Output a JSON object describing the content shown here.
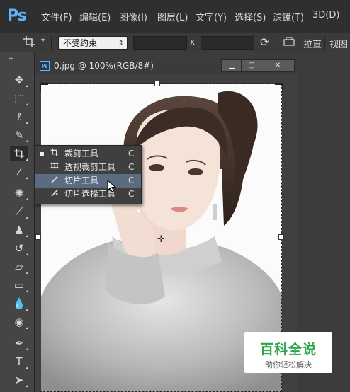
{
  "app": {
    "logo": "Ps"
  },
  "menu": [
    "文件(F)",
    "编辑(E)",
    "图像(I)",
    "图层(L)",
    "文字(Y)",
    "选择(S)",
    "滤镜(T)",
    "3D(D)"
  ],
  "options": {
    "ratio_value": "不受约束",
    "x_label": "x",
    "straighten_label": "拉直",
    "view_label": "视图"
  },
  "document": {
    "icon_text": "Ps",
    "title": "0.jpg @ 100%(RGB/8#)",
    "min_label": "▁",
    "max_label": "□",
    "close_label": "✕"
  },
  "flyout": {
    "items": [
      {
        "label": "裁剪工具",
        "key": "C",
        "bullet": "▪",
        "icon": "crop-icon"
      },
      {
        "label": "透视裁剪工具",
        "key": "C",
        "bullet": "",
        "icon": "perspective-crop-icon"
      },
      {
        "label": "切片工具",
        "key": "C",
        "bullet": "",
        "icon": "slice-icon"
      },
      {
        "label": "切片选择工具",
        "key": "C",
        "bullet": "",
        "icon": "slice-select-icon"
      }
    ],
    "hover_index": 2
  },
  "watermark": {
    "title": "百科全说",
    "subtitle": "助你轻松解决"
  },
  "colors": {
    "ps_blue": "#5fb3f6",
    "watermark_green": "#2ca84a",
    "menu_hover": "#5b6b80"
  }
}
